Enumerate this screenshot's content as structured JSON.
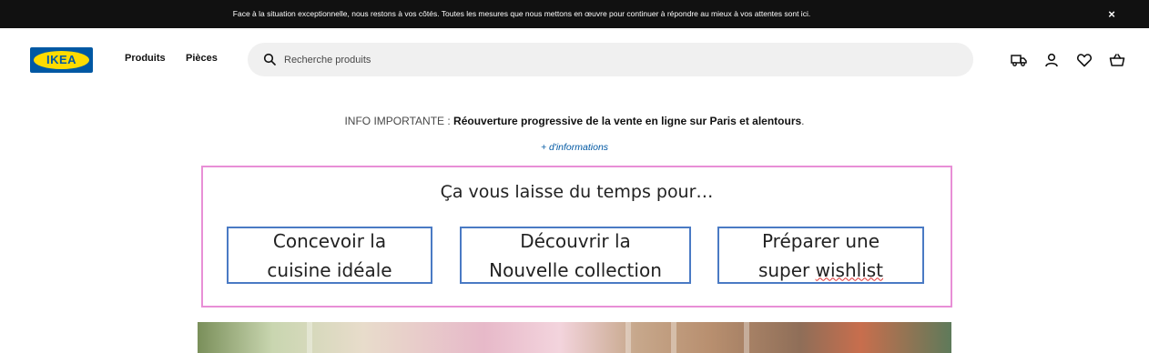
{
  "announcement": {
    "text": "Face à la situation exceptionnelle, nous restons à vos côtés. Toutes les mesures que nous mettons en œuvre pour continuer à répondre au mieux à vos attentes sont ici.",
    "close_label": "×"
  },
  "header": {
    "logo_text": "IKEA",
    "nav": [
      "Produits",
      "Pièces"
    ],
    "search_placeholder": "Recherche produits",
    "icons": [
      "delivery-truck-icon",
      "user-icon",
      "heart-icon",
      "shopping-bag-icon"
    ]
  },
  "info": {
    "prefix": "INFO IMPORTANTE : ",
    "message": "Réouverture progressive de la vente en ligne sur Paris et alentours",
    "suffix": ".",
    "more_link": "+ d'informations"
  },
  "promo": {
    "title": "Ça vous laisse du temps pour…",
    "boxes": [
      {
        "line1": "Concevoir la",
        "line2": "cuisine idéale"
      },
      {
        "line1": "Découvrir la",
        "line2": "Nouvelle collection"
      },
      {
        "line1": "Préparer une",
        "line2_part1": "super ",
        "line2_part2": "wishlist"
      }
    ]
  },
  "colors": {
    "topbar_bg": "#111111",
    "brand_blue": "#0058a3",
    "brand_yellow": "#ffdb00",
    "promo_border": "#e88fd6",
    "box_border": "#4a7ac4"
  }
}
